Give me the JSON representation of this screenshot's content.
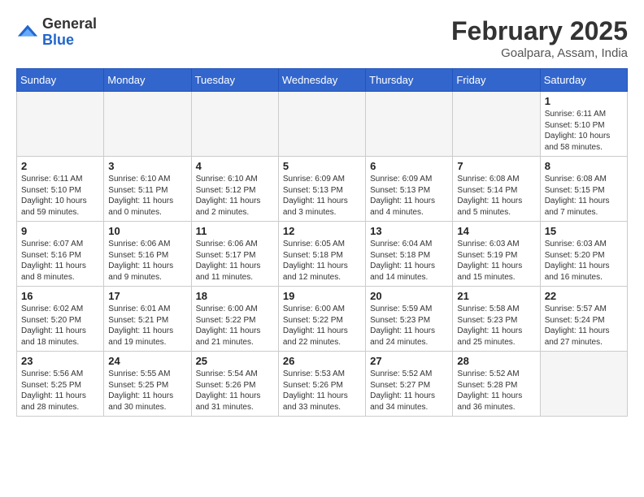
{
  "header": {
    "logo_general": "General",
    "logo_blue": "Blue",
    "month_title": "February 2025",
    "location": "Goalpara, Assam, India"
  },
  "weekdays": [
    "Sunday",
    "Monday",
    "Tuesday",
    "Wednesday",
    "Thursday",
    "Friday",
    "Saturday"
  ],
  "weeks": [
    [
      {
        "day": "",
        "info": ""
      },
      {
        "day": "",
        "info": ""
      },
      {
        "day": "",
        "info": ""
      },
      {
        "day": "",
        "info": ""
      },
      {
        "day": "",
        "info": ""
      },
      {
        "day": "",
        "info": ""
      },
      {
        "day": "1",
        "info": "Sunrise: 6:11 AM\nSunset: 5:10 PM\nDaylight: 10 hours\nand 58 minutes."
      }
    ],
    [
      {
        "day": "2",
        "info": "Sunrise: 6:11 AM\nSunset: 5:10 PM\nDaylight: 10 hours\nand 59 minutes."
      },
      {
        "day": "3",
        "info": "Sunrise: 6:10 AM\nSunset: 5:11 PM\nDaylight: 11 hours\nand 0 minutes."
      },
      {
        "day": "4",
        "info": "Sunrise: 6:10 AM\nSunset: 5:12 PM\nDaylight: 11 hours\nand 2 minutes."
      },
      {
        "day": "5",
        "info": "Sunrise: 6:09 AM\nSunset: 5:13 PM\nDaylight: 11 hours\nand 3 minutes."
      },
      {
        "day": "6",
        "info": "Sunrise: 6:09 AM\nSunset: 5:13 PM\nDaylight: 11 hours\nand 4 minutes."
      },
      {
        "day": "7",
        "info": "Sunrise: 6:08 AM\nSunset: 5:14 PM\nDaylight: 11 hours\nand 5 minutes."
      },
      {
        "day": "8",
        "info": "Sunrise: 6:08 AM\nSunset: 5:15 PM\nDaylight: 11 hours\nand 7 minutes."
      }
    ],
    [
      {
        "day": "9",
        "info": "Sunrise: 6:07 AM\nSunset: 5:16 PM\nDaylight: 11 hours\nand 8 minutes."
      },
      {
        "day": "10",
        "info": "Sunrise: 6:06 AM\nSunset: 5:16 PM\nDaylight: 11 hours\nand 9 minutes."
      },
      {
        "day": "11",
        "info": "Sunrise: 6:06 AM\nSunset: 5:17 PM\nDaylight: 11 hours\nand 11 minutes."
      },
      {
        "day": "12",
        "info": "Sunrise: 6:05 AM\nSunset: 5:18 PM\nDaylight: 11 hours\nand 12 minutes."
      },
      {
        "day": "13",
        "info": "Sunrise: 6:04 AM\nSunset: 5:18 PM\nDaylight: 11 hours\nand 14 minutes."
      },
      {
        "day": "14",
        "info": "Sunrise: 6:03 AM\nSunset: 5:19 PM\nDaylight: 11 hours\nand 15 minutes."
      },
      {
        "day": "15",
        "info": "Sunrise: 6:03 AM\nSunset: 5:20 PM\nDaylight: 11 hours\nand 16 minutes."
      }
    ],
    [
      {
        "day": "16",
        "info": "Sunrise: 6:02 AM\nSunset: 5:20 PM\nDaylight: 11 hours\nand 18 minutes."
      },
      {
        "day": "17",
        "info": "Sunrise: 6:01 AM\nSunset: 5:21 PM\nDaylight: 11 hours\nand 19 minutes."
      },
      {
        "day": "18",
        "info": "Sunrise: 6:00 AM\nSunset: 5:22 PM\nDaylight: 11 hours\nand 21 minutes."
      },
      {
        "day": "19",
        "info": "Sunrise: 6:00 AM\nSunset: 5:22 PM\nDaylight: 11 hours\nand 22 minutes."
      },
      {
        "day": "20",
        "info": "Sunrise: 5:59 AM\nSunset: 5:23 PM\nDaylight: 11 hours\nand 24 minutes."
      },
      {
        "day": "21",
        "info": "Sunrise: 5:58 AM\nSunset: 5:23 PM\nDaylight: 11 hours\nand 25 minutes."
      },
      {
        "day": "22",
        "info": "Sunrise: 5:57 AM\nSunset: 5:24 PM\nDaylight: 11 hours\nand 27 minutes."
      }
    ],
    [
      {
        "day": "23",
        "info": "Sunrise: 5:56 AM\nSunset: 5:25 PM\nDaylight: 11 hours\nand 28 minutes."
      },
      {
        "day": "24",
        "info": "Sunrise: 5:55 AM\nSunset: 5:25 PM\nDaylight: 11 hours\nand 30 minutes."
      },
      {
        "day": "25",
        "info": "Sunrise: 5:54 AM\nSunset: 5:26 PM\nDaylight: 11 hours\nand 31 minutes."
      },
      {
        "day": "26",
        "info": "Sunrise: 5:53 AM\nSunset: 5:26 PM\nDaylight: 11 hours\nand 33 minutes."
      },
      {
        "day": "27",
        "info": "Sunrise: 5:52 AM\nSunset: 5:27 PM\nDaylight: 11 hours\nand 34 minutes."
      },
      {
        "day": "28",
        "info": "Sunrise: 5:52 AM\nSunset: 5:28 PM\nDaylight: 11 hours\nand 36 minutes."
      },
      {
        "day": "",
        "info": ""
      }
    ]
  ]
}
